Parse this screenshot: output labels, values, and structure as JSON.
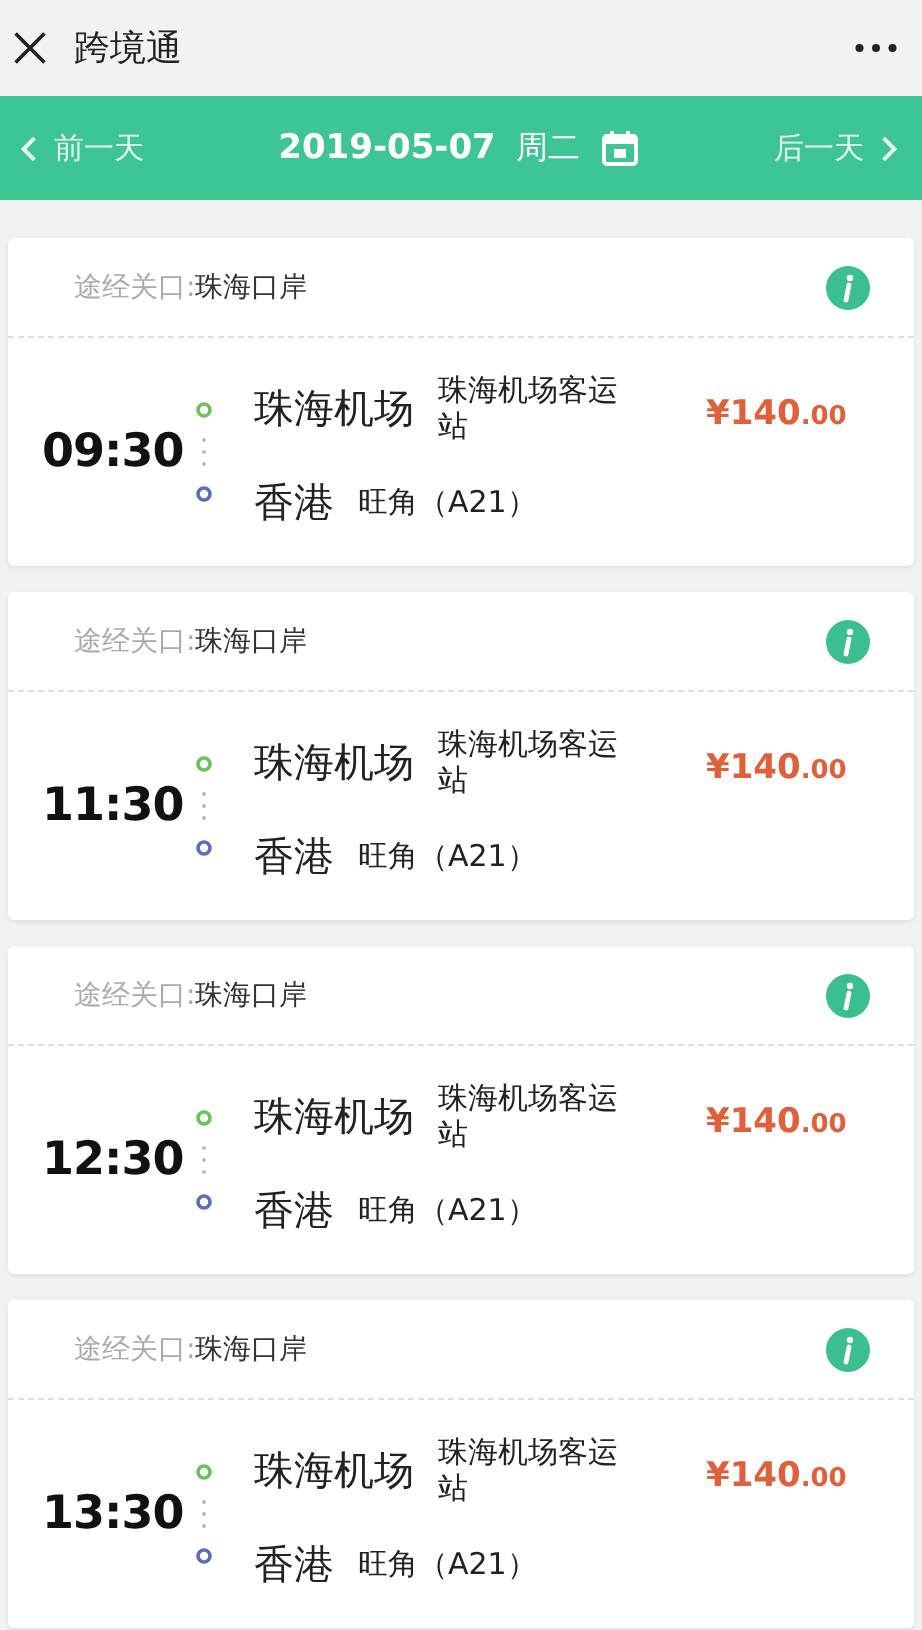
{
  "window": {
    "title": "跨境通"
  },
  "date_bar": {
    "prev": "前一天",
    "date": "2019-05-07",
    "weekday": "周二",
    "next": "后一天"
  },
  "trips": [
    {
      "port_label": "途经关口:",
      "port": "珠海口岸",
      "time": "09:30",
      "from": "珠海机场",
      "from_stop": "珠海机场客运站",
      "to": "香港",
      "to_stop": "旺角（A21）",
      "price": "¥140",
      "price_decimal": ".00"
    },
    {
      "port_label": "途经关口:",
      "port": "珠海口岸",
      "time": "11:30",
      "from": "珠海机场",
      "from_stop": "珠海机场客运站",
      "to": "香港",
      "to_stop": "旺角（A21）",
      "price": "¥140",
      "price_decimal": ".00"
    },
    {
      "port_label": "途经关口:",
      "port": "珠海口岸",
      "time": "12:30",
      "from": "珠海机场",
      "from_stop": "珠海机场客运站",
      "to": "香港",
      "to_stop": "旺角（A21）",
      "price": "¥140",
      "price_decimal": ".00"
    },
    {
      "port_label": "途经关口:",
      "port": "珠海口岸",
      "time": "13:30",
      "from": "珠海机场",
      "from_stop": "珠海机场客运站",
      "to": "香港",
      "to_stop": "旺角（A21）",
      "price": "¥140",
      "price_decimal": ".00"
    }
  ]
}
